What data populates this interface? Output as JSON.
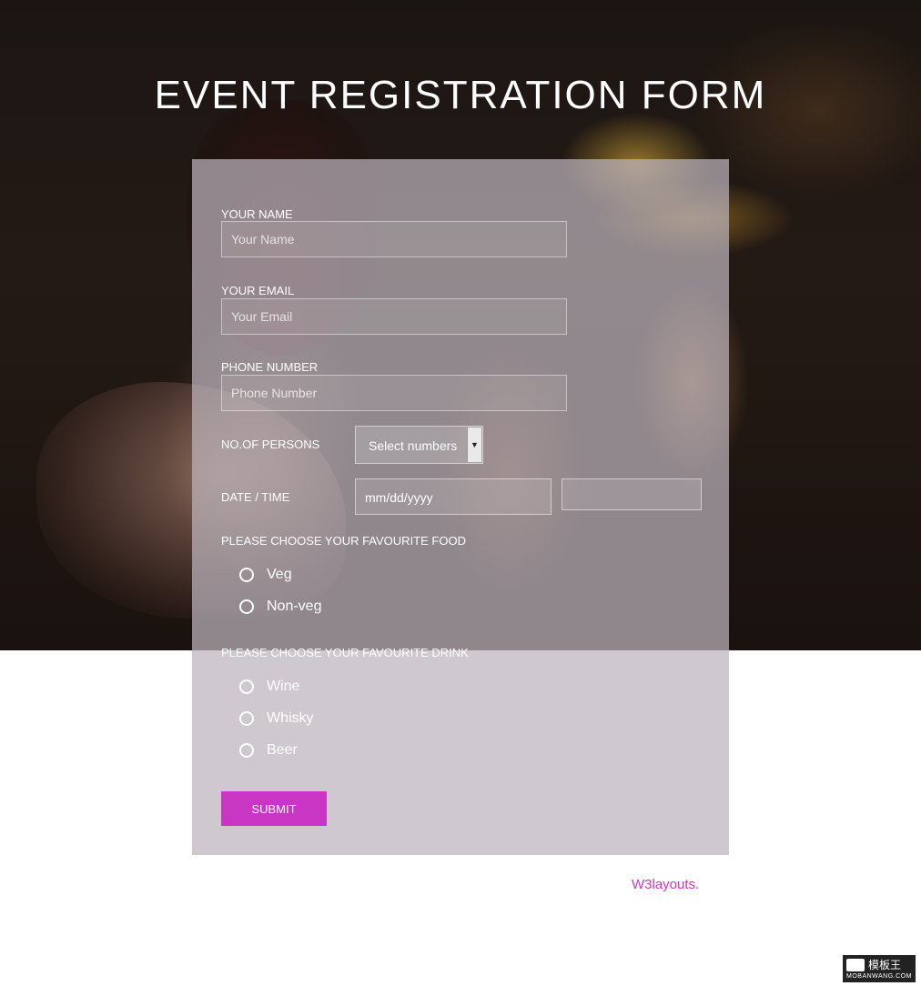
{
  "page": {
    "title": "EVENT REGISTRATION FORM"
  },
  "form": {
    "name": {
      "label": "YOUR NAME",
      "placeholder": "Your Name",
      "value": ""
    },
    "email": {
      "label": "YOUR EMAIL",
      "placeholder": "Your Email",
      "value": ""
    },
    "phone": {
      "label": "PHONE NUMBER",
      "placeholder": "Phone Number",
      "value": ""
    },
    "persons": {
      "label": "NO.OF PERSONS",
      "selected": "Select numbers"
    },
    "datetime": {
      "label": "DATE / TIME",
      "date_value": "mm/dd/yyyy",
      "time_value": ""
    },
    "food": {
      "label": "PLEASE CHOOSE YOUR FAVOURITE FOOD",
      "options": [
        "Veg",
        "Non-veg"
      ]
    },
    "drink": {
      "label": "PLEASE CHOOSE YOUR FAVOURITE DRINK",
      "options": [
        "Wine",
        "Whisky",
        "Beer"
      ]
    },
    "submit_label": "SUBMIT"
  },
  "footer": {
    "credit": "W3layouts."
  },
  "watermark": {
    "brand": "模板王",
    "site": "MOBANWANG.COM"
  },
  "colors": {
    "accent": "#c936c3",
    "panel": "rgba(188,180,188,0.72)"
  }
}
